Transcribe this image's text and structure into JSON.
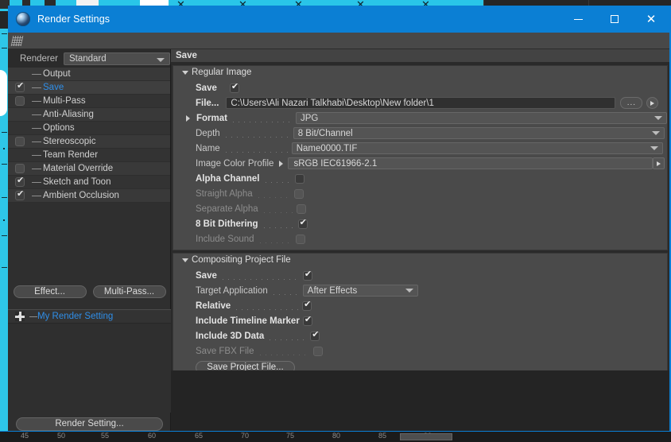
{
  "window": {
    "title": "Render Settings",
    "icon": "cinema4d-sphere-icon",
    "minimize": "–",
    "maximize": "□",
    "close": "✕",
    "accent_color": "#0b7fd4"
  },
  "left_panel": {
    "renderer_label": "Renderer",
    "renderer_value": "Standard",
    "tree": [
      {
        "label": "Output",
        "checkbox": "none",
        "selected": false
      },
      {
        "label": "Save",
        "checkbox": "checked",
        "selected": true
      },
      {
        "label": "Multi-Pass",
        "checkbox": "unchecked",
        "selected": false
      },
      {
        "label": "Anti-Aliasing",
        "checkbox": "none",
        "selected": false
      },
      {
        "label": "Options",
        "checkbox": "none",
        "selected": false
      },
      {
        "label": "Stereoscopic",
        "checkbox": "unchecked",
        "selected": false
      },
      {
        "label": "Team Render",
        "checkbox": "none",
        "selected": false
      },
      {
        "label": "Material Override",
        "checkbox": "unchecked",
        "selected": false
      },
      {
        "label": "Sketch and Toon",
        "checkbox": "checked",
        "selected": false
      },
      {
        "label": "Ambient Occlusion",
        "checkbox": "checked",
        "selected": false
      }
    ],
    "effect_button": "Effect...",
    "multipass_button": "Multi-Pass...",
    "render_setting_name": "My Render Setting",
    "render_setting_button": "Render Setting..."
  },
  "right_panel": {
    "title": "Save",
    "groups": [
      {
        "name": "Regular Image",
        "rows": [
          {
            "label": "Save",
            "type": "checkbox",
            "value": "checked",
            "state": "on"
          },
          {
            "label": "File...",
            "type": "path",
            "value": "C:\\Users\\Ali Nazari Talkhabi\\Desktop\\New folder\\1",
            "state": "on",
            "buttons": [
              "...",
              "►"
            ]
          },
          {
            "label": "Format",
            "type": "dropdown",
            "value": "JPG",
            "state": "on",
            "expander": "►"
          },
          {
            "label": "Depth",
            "type": "dropdown",
            "value": "8 Bit/Channel",
            "state": "soft"
          },
          {
            "label": "Name",
            "type": "dropdown",
            "value": "Name0000.TIF",
            "state": "soft"
          },
          {
            "label": "Image Color Profile",
            "type": "profile",
            "value": "sRGB IEC61966-2.1",
            "state": "soft",
            "expander": "►"
          },
          {
            "label": "Alpha Channel",
            "type": "checkbox",
            "value": "unchecked",
            "state": "on"
          },
          {
            "label": "Straight Alpha",
            "type": "checkbox",
            "value": "unchecked",
            "state": "off"
          },
          {
            "label": "Separate Alpha",
            "type": "checkbox",
            "value": "unchecked",
            "state": "off"
          },
          {
            "label": "8 Bit Dithering",
            "type": "checkbox",
            "value": "checked",
            "state": "on"
          },
          {
            "label": "Include Sound",
            "type": "checkbox",
            "value": "unchecked",
            "state": "off"
          }
        ]
      },
      {
        "name": "Compositing Project File",
        "rows": [
          {
            "label": "Save",
            "type": "checkbox",
            "value": "checked",
            "state": "on"
          },
          {
            "label": "Target Application",
            "type": "dropdown",
            "value": "After Effects",
            "state": "soft"
          },
          {
            "label": "Relative",
            "type": "checkbox",
            "value": "checked",
            "state": "on"
          },
          {
            "label": "Include Timeline Marker",
            "type": "checkbox",
            "value": "checked",
            "state": "on"
          },
          {
            "label": "Include 3D Data",
            "type": "checkbox",
            "value": "checked",
            "state": "on"
          },
          {
            "label": "Save FBX File",
            "type": "checkbox",
            "value": "unchecked",
            "state": "off"
          }
        ],
        "action_button": "Save Project File..."
      }
    ]
  },
  "timeline": {
    "ticks": [
      "45",
      "50",
      "55",
      "60",
      "65",
      "70",
      "75",
      "80",
      "85",
      "90"
    ]
  }
}
